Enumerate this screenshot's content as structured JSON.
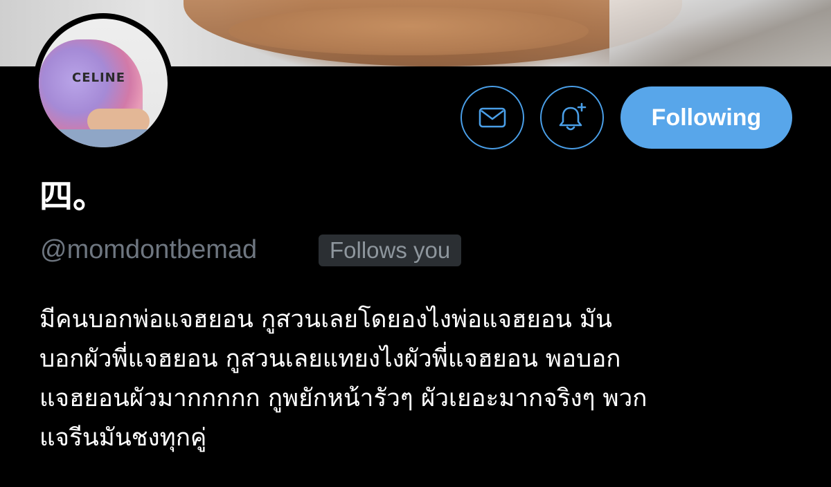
{
  "profile": {
    "display_name": "四。",
    "handle": "@momdontbemad",
    "follows_you_badge": "Follows you",
    "bio_lines": [
      "มีคนบอกพ่อแจฮยอน กูสวนเลยโดยองไงพ่อแจฮยอน มัน",
      "บอกผัวพี่แจฮยอน กูสวนเลยแทยงไงผัวพี่แจฮยอน พอบอก",
      "แจฮยอนผัวมากกกกก กูพยักหน้ารัวๆ ผัวเยอะมากจริงๆ พวก",
      "แจรีนมันชงทุกคู่"
    ],
    "avatar_shirt_text": "CELINE"
  },
  "actions": {
    "message_icon": "mail-icon",
    "notify_icon": "bell-plus-icon",
    "follow_label": "Following"
  },
  "colors": {
    "background": "#000000",
    "accent_blue": "#58a6ea",
    "outline_blue": "#4a9fe8",
    "muted_text": "#6e7680",
    "badge_bg": "#2b2f33"
  }
}
